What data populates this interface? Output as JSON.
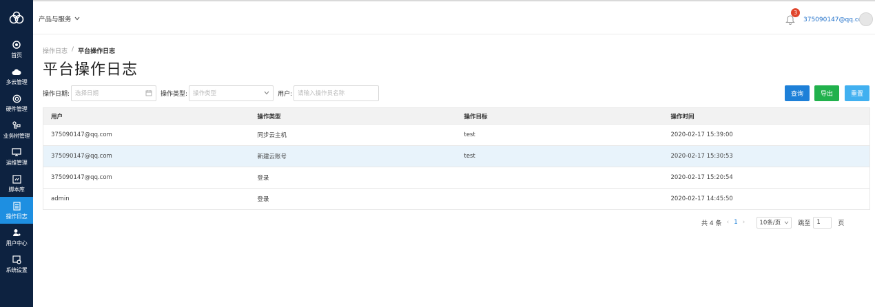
{
  "sidebar": {
    "items": [
      {
        "label": "首页",
        "icon": "home-icon"
      },
      {
        "label": "多云管理",
        "icon": "cloud-icon"
      },
      {
        "label": "硬件管理",
        "icon": "hardware-icon"
      },
      {
        "label": "业务树管理",
        "icon": "tree-icon"
      },
      {
        "label": "运维管理",
        "icon": "monitor-icon"
      },
      {
        "label": "脚本库",
        "icon": "script-icon"
      },
      {
        "label": "操作日志",
        "icon": "log-icon",
        "active": true
      },
      {
        "label": "用户中心",
        "icon": "user-icon"
      },
      {
        "label": "系统设置",
        "icon": "settings-icon"
      }
    ]
  },
  "header": {
    "product_menu": "产品与服务",
    "notification_count": "3",
    "user_email": "375090147@qq.com"
  },
  "breadcrumb": {
    "parent": "操作日志",
    "separator": "/",
    "current": "平台操作日志"
  },
  "page_title": "平台操作日志",
  "filters": {
    "date_label": "操作日期:",
    "date_placeholder": "选择日期",
    "type_label": "操作类型:",
    "type_placeholder": "操作类型",
    "user_label": "用户:",
    "user_placeholder": "请输入操作员名称"
  },
  "buttons": {
    "query": "查询",
    "export": "导出",
    "reset": "重置"
  },
  "table": {
    "columns": [
      "用户",
      "操作类型",
      "操作目标",
      "操作时间"
    ],
    "rows": [
      {
        "user": "375090147@qq.com",
        "type": "同步云主机",
        "target": "test",
        "time": "2020-02-17 15:39:00"
      },
      {
        "user": "375090147@qq.com",
        "type": "新建云账号",
        "target": "test",
        "time": "2020-02-17 15:30:53"
      },
      {
        "user": "375090147@qq.com",
        "type": "登录",
        "target": "",
        "time": "2020-02-17 15:20:54"
      },
      {
        "user": "admin",
        "type": "登录",
        "target": "",
        "time": "2020-02-17 14:45:50"
      }
    ]
  },
  "pagination": {
    "total": "共 4 条",
    "current_page": "1",
    "page_size": "10条/页",
    "goto_label": "跳至",
    "goto_value": "1",
    "goto_unit": "页"
  },
  "colors": {
    "sidebar_bg": "#0d2240",
    "active_nav": "#1e8fe1",
    "query_btn": "#1e80d8",
    "export_btn": "#21b14c",
    "reset_btn": "#41b0f0",
    "badge": "#e0452c"
  }
}
